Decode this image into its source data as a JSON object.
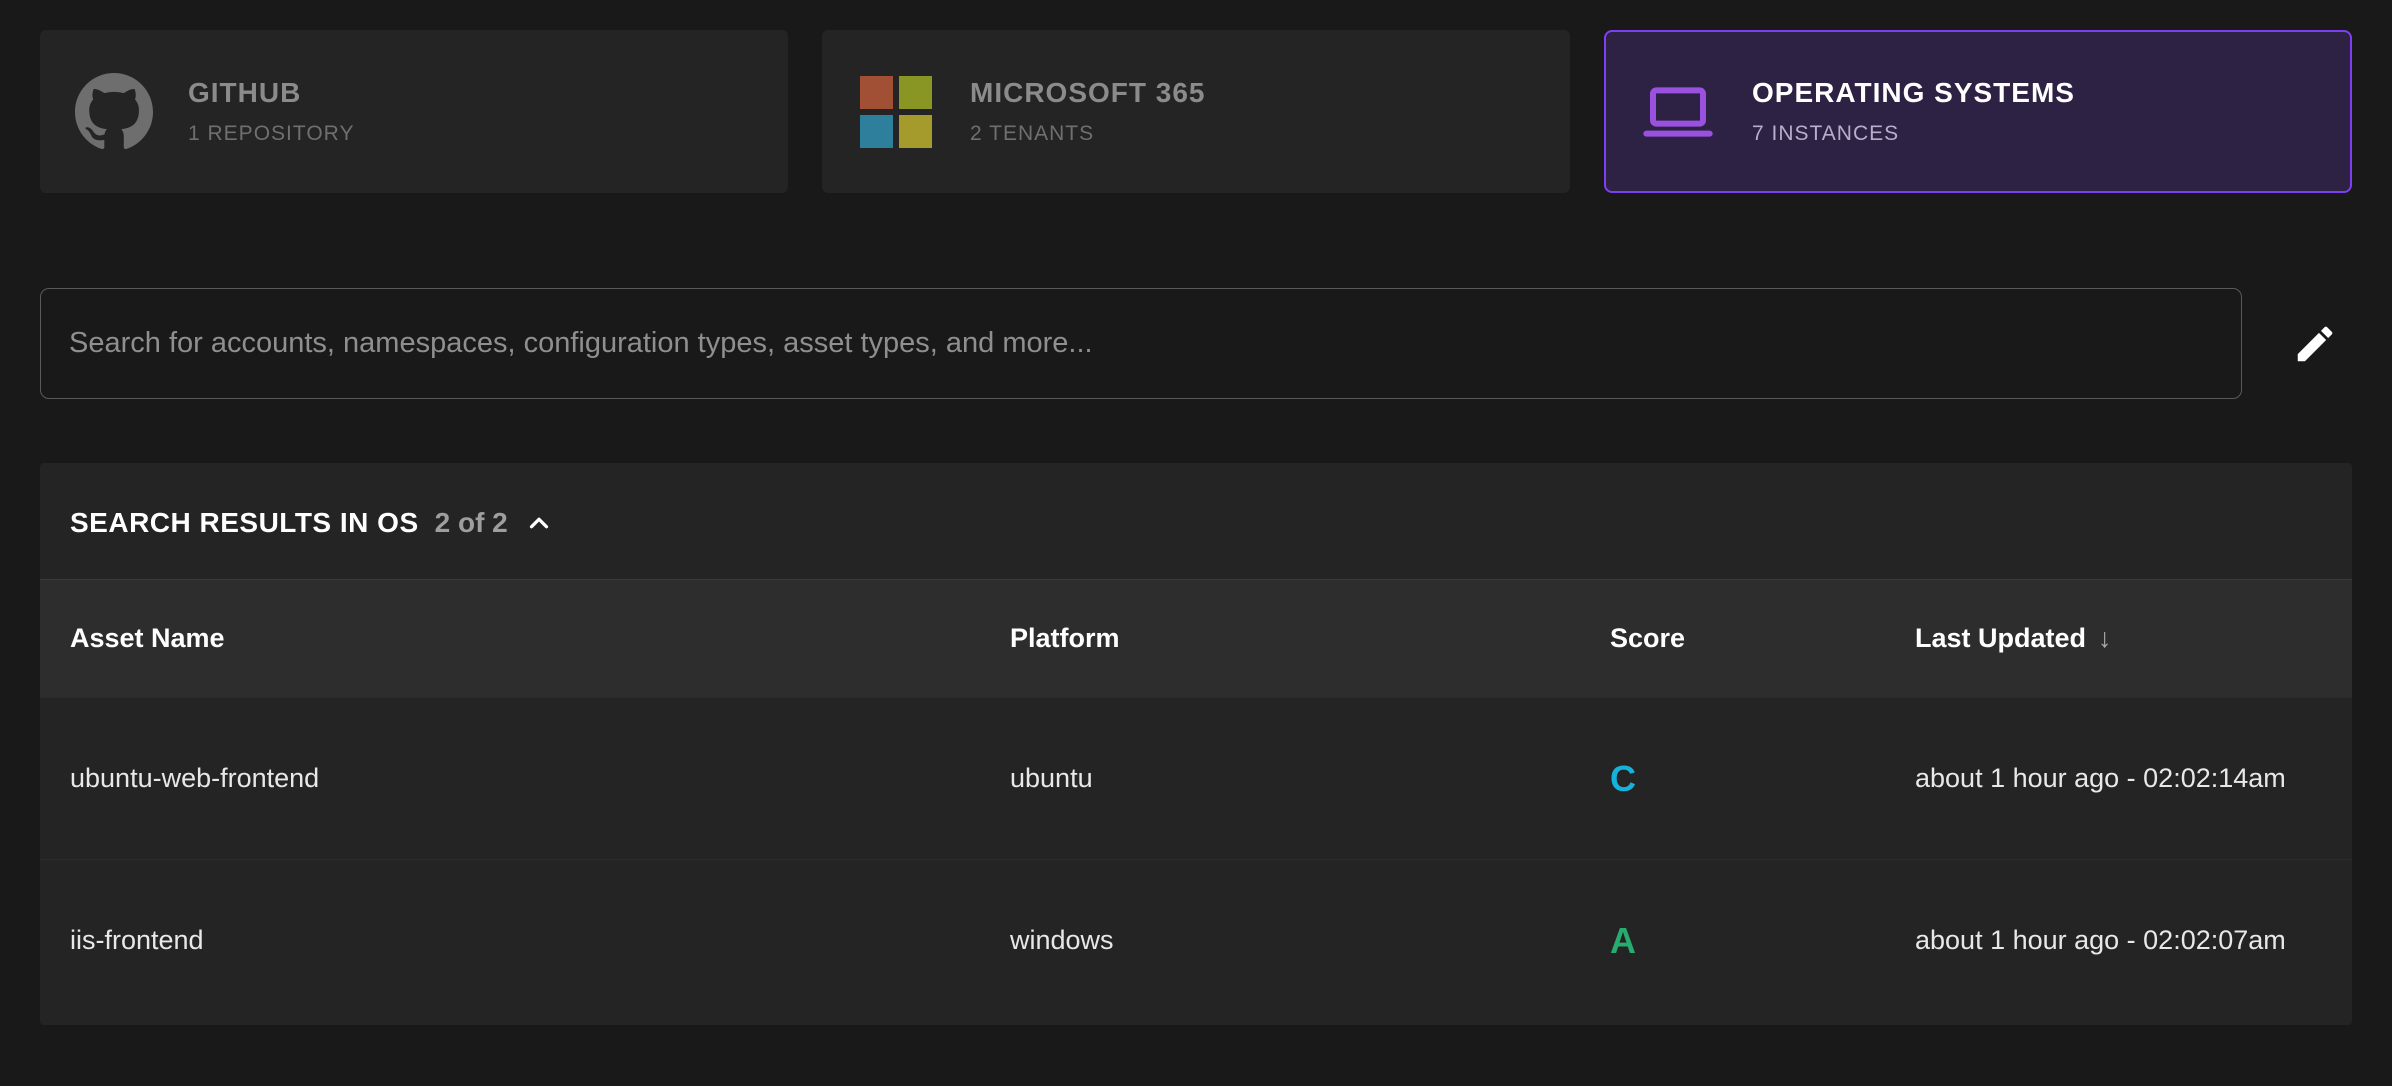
{
  "colors": {
    "accent_purple": "#7e3ff2",
    "selected_card_bg": "#2e2244",
    "github_icon": "#6e6e6e",
    "laptop_icon": "#9b51e0",
    "score_c": "#17b1de",
    "score_a": "#27ab6e"
  },
  "cards": [
    {
      "title": "GITHUB",
      "subtitle": "1 REPOSITORY",
      "icon": "github-icon"
    },
    {
      "title": "MICROSOFT 365",
      "subtitle": "2 TENANTS",
      "icon": "microsoft-logo",
      "logo_colors": [
        "#a14f35",
        "#8a9623",
        "#2d7f9b",
        "#a59a2c"
      ]
    },
    {
      "title": "OPERATING SYSTEMS",
      "subtitle": "7 INSTANCES",
      "icon": "laptop-icon",
      "selected": true
    }
  ],
  "search": {
    "placeholder": "Search for accounts, namespaces, configuration types, asset types, and more...",
    "value": "",
    "edit_icon": "pencil-icon"
  },
  "results": {
    "title": "SEARCH RESULTS IN OS",
    "count": "2 of 2",
    "collapse_icon": "chevron-up-icon",
    "columns": {
      "asset_name": "Asset Name",
      "platform": "Platform",
      "score": "Score",
      "last_updated": "Last Updated"
    },
    "sort": {
      "column": "Last Updated",
      "direction": "desc",
      "icon": "arrow-down-icon",
      "glyph": "↓"
    },
    "rows": [
      {
        "asset_name": "ubuntu-web-frontend",
        "platform": "ubuntu",
        "score": "C",
        "score_color": "#17b1de",
        "last_updated": "about 1 hour ago - 02:02:14am"
      },
      {
        "asset_name": "iis-frontend",
        "platform": "windows",
        "score": "A",
        "score_color": "#27ab6e",
        "last_updated": "about 1 hour ago - 02:02:07am"
      }
    ]
  }
}
